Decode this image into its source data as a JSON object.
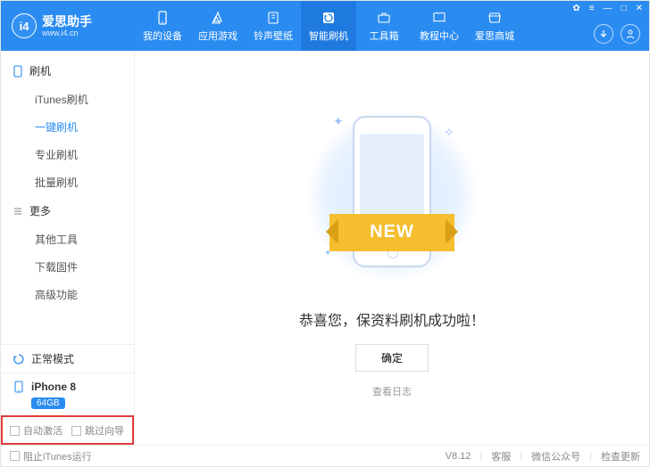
{
  "header": {
    "logo_text": "i4",
    "brand_title": "爱思助手",
    "brand_url": "www.i4.cn",
    "nav": [
      {
        "label": "我的设备",
        "icon": "phone-icon"
      },
      {
        "label": "应用游戏",
        "icon": "apps-icon"
      },
      {
        "label": "铃声壁纸",
        "icon": "music-icon"
      },
      {
        "label": "智能刷机",
        "icon": "flash-icon"
      },
      {
        "label": "工具箱",
        "icon": "toolbox-icon"
      },
      {
        "label": "教程中心",
        "icon": "book-icon"
      },
      {
        "label": "爱思商城",
        "icon": "shop-icon"
      }
    ],
    "active_nav_index": 3,
    "win_controls": {
      "settings": "✿",
      "menu": "≡",
      "min": "—",
      "max": "□",
      "close": "✕"
    }
  },
  "sidebar": {
    "groups": [
      {
        "title": "刷机",
        "icon": "device-icon",
        "items": [
          "iTunes刷机",
          "一键刷机",
          "专业刷机",
          "批量刷机"
        ],
        "active_index": 1
      },
      {
        "title": "更多",
        "icon": "list-icon",
        "items": [
          "其他工具",
          "下载固件",
          "高级功能"
        ],
        "active_index": -1
      }
    ],
    "mode": "正常模式",
    "device": {
      "name": "iPhone 8",
      "storage": "64GB"
    },
    "options": {
      "auto_activate": "自动激活",
      "skip_guide": "跳过向导",
      "highlighted": true
    }
  },
  "main": {
    "ribbon_text": "NEW",
    "success_text": "恭喜您，保资料刷机成功啦！",
    "confirm_label": "确定",
    "log_label": "查看日志"
  },
  "footer": {
    "block_itunes": "阻止iTunes运行",
    "version": "V8.12",
    "support": "客服",
    "wechat": "微信公众号",
    "update": "检查更新"
  }
}
